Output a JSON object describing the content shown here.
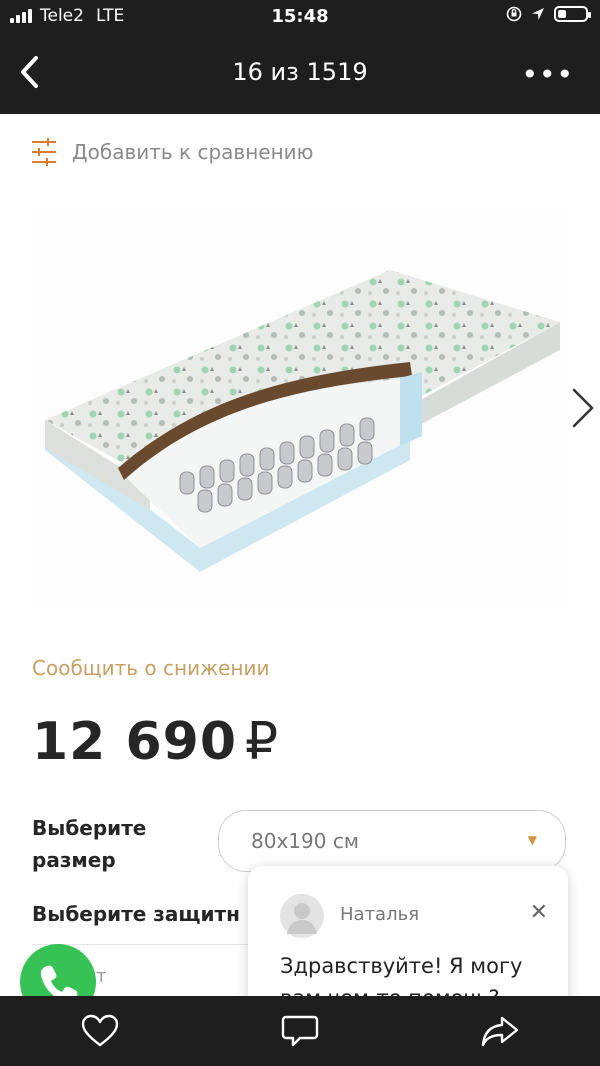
{
  "status_bar": {
    "carrier": "Tele2",
    "network": "LTE",
    "time": "15:48",
    "battery_level": 0.3
  },
  "nav": {
    "title": "16 из 1519",
    "more": "•••"
  },
  "compare": {
    "label": "Добавить к сравнению"
  },
  "product": {
    "notify_label": "Сообщить о снижении",
    "price": "12 690",
    "currency": "₽",
    "size_label": "Выберите размер",
    "size_value": "80x190 см",
    "protection_label": "Выберите защитн",
    "partial_text": "т"
  },
  "chat": {
    "name": "Наталья",
    "message": "Здравствуйте! Я могу вам чем-то помочь?"
  },
  "colors": {
    "bar_background": "#1e1e1e",
    "accent_gold": "#c8a064",
    "phone_green": "#37c256",
    "compare_orange": "#e07a2e"
  },
  "icons": [
    "back-chevron-icon",
    "more-dots-icon",
    "compare-sliders-icon",
    "next-arrow-icon",
    "phone-icon",
    "heart-icon",
    "chat-bubble-icon",
    "share-icon",
    "close-icon",
    "caret-down-icon"
  ]
}
